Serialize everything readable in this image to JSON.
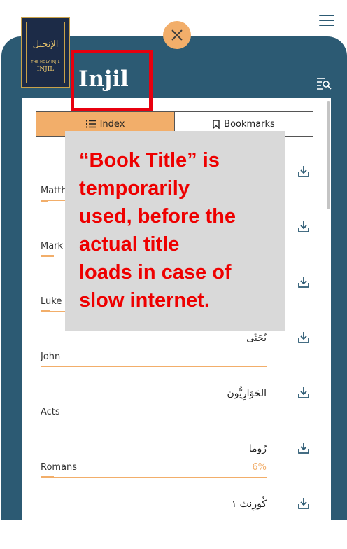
{
  "book": {
    "title": "Injil",
    "cover_arabic": "الإنجيل",
    "cover_small": "THE HOLY INJIL",
    "cover_big": "INJIL"
  },
  "tabs": [
    {
      "label": "Index",
      "active": true
    },
    {
      "label": "Bookmarks",
      "active": false
    }
  ],
  "annotation": {
    "lines": [
      "“Book Title” is",
      "temporarily",
      "used, before the",
      "actual title",
      "loads in case of",
      "slow internet."
    ]
  },
  "chapters": [
    {
      "name": "Matthew",
      "arabic": "",
      "percent": "",
      "progress": 0.03
    },
    {
      "name": "Mark",
      "arabic": "",
      "percent": "",
      "progress": 0.06
    },
    {
      "name": "Luke",
      "arabic": "",
      "percent": "",
      "progress": 0.04
    },
    {
      "name": "John",
      "arabic": "يُحَنّى",
      "percent": "",
      "progress": 0
    },
    {
      "name": "Acts",
      "arabic": "الحَوَارِيُّون",
      "percent": "",
      "progress": 0
    },
    {
      "name": "Romans",
      "arabic": "رُوما",
      "percent": "6%",
      "progress": 0.06
    },
    {
      "name": "",
      "arabic": "كُورِنث ١",
      "percent": "",
      "progress": 0
    }
  ],
  "colors": {
    "header": "#2c5a73",
    "accent": "#f2ae6a",
    "highlight": "#e8000f",
    "note_text": "#ee0000"
  },
  "icons": [
    "menu-icon",
    "close-icon",
    "search-list-icon",
    "list-icon",
    "bookmark-icon",
    "download-icon"
  ]
}
